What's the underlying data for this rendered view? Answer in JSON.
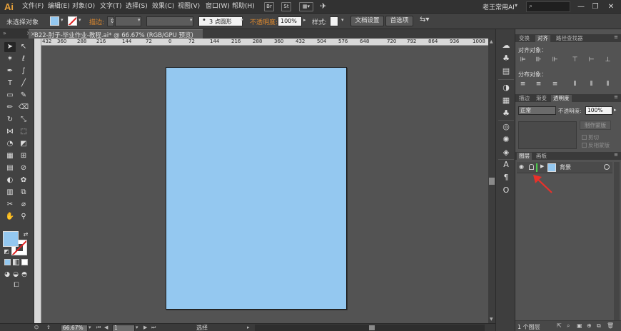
{
  "menubar": {
    "logo": "Ai",
    "items": [
      "文件(F)",
      "编辑(E)",
      "对象(O)",
      "文字(T)",
      "选择(S)",
      "效果(C)",
      "视图(V)",
      "窗口(W)",
      "帮助(H)"
    ],
    "icon_labels": [
      "Br",
      "St"
    ],
    "workspace": "老王常用AI",
    "window_buttons": [
      "—",
      "❐",
      "✕"
    ]
  },
  "controlbar": {
    "selection_status": "未选择对象",
    "fill_color": "#94c8f0",
    "stroke_label": "描边:",
    "stroke_weight": "",
    "stroke_profile": "3 点圆形",
    "opacity_label": "不透明度:",
    "opacity_value": "100%",
    "style_label": "样式:",
    "document_setup_button": "文档设置",
    "preferences_button": "首选项"
  },
  "document": {
    "tab_title": "B22-肘子-毕业作业-教程.ai* @ 66.67% (RGB/GPU 预览)",
    "artboard_color": "#94c8f0"
  },
  "ruler": {
    "labels": [
      "432",
      "360",
      "288",
      "216",
      "144",
      "72",
      "0",
      "72",
      "144",
      "216",
      "288",
      "360",
      "432",
      "504",
      "576",
      "648",
      "720",
      "792",
      "864",
      "936",
      "1008"
    ]
  },
  "status": {
    "zoom": "66.67%",
    "artboard_number": "1",
    "tool_name": "选择"
  },
  "align_panel": {
    "tabs": [
      "变换",
      "对齐",
      "路径查找器"
    ],
    "active_tab": "对齐",
    "align_objects_label": "对齐对象：",
    "distribute_objects_label": "分布对象："
  },
  "transparency_panel": {
    "tabs": [
      "描边",
      "渐变",
      "透明度"
    ],
    "active_tab": "透明度",
    "blend_mode": "正常",
    "opacity_label": "不透明度:",
    "opacity_value": "100%",
    "make_mask_button": "制作蒙版",
    "clip_label": "剪切",
    "invert_mask_label": "反相蒙版"
  },
  "layers_panel": {
    "tabs": [
      "图层",
      "画板"
    ],
    "active_tab": "图层",
    "layers": [
      {
        "name": "背景",
        "color": "#4fca4f",
        "thumb_color": "#94c8f0"
      }
    ],
    "layer_count": "1 个图层"
  },
  "colors": {
    "accent_orange": "#e08a2e",
    "annotation_arrow": "#e8312a"
  }
}
